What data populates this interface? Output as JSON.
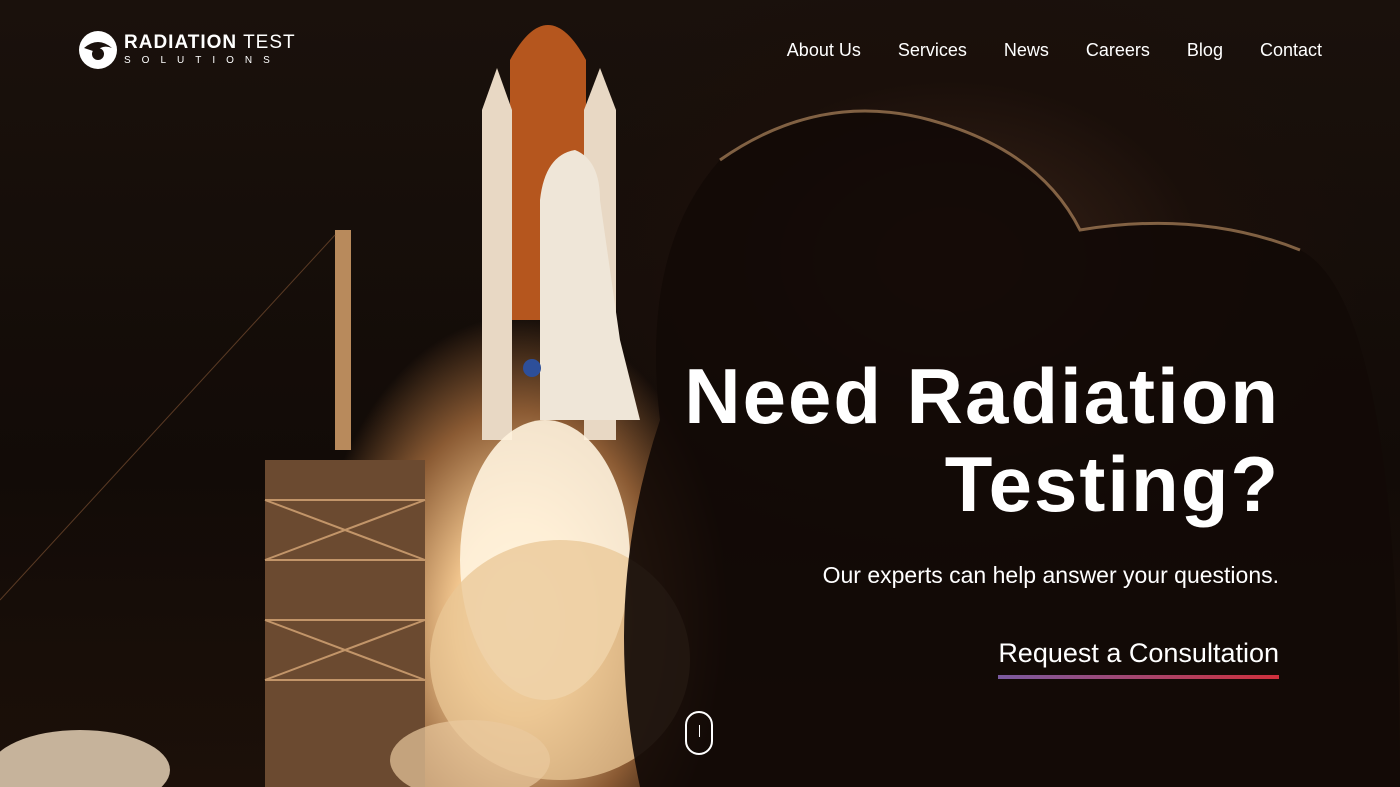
{
  "brand": {
    "line1_bold": "RADIATION",
    "line1_light": " TEST",
    "line2": "SOLUTIONS",
    "logo_icon": "eye-globe-icon"
  },
  "nav": {
    "items": [
      "About Us",
      "Services",
      "News",
      "Careers",
      "Blog",
      "Contact"
    ]
  },
  "hero": {
    "headline_line1": "Need Radiation",
    "headline_line2": "Testing?",
    "subtitle": "Our experts can help answer your questions.",
    "cta_label": "Request a Consultation",
    "background": "space-shuttle-launch-photo",
    "scroll_icon": "mouse-scroll-icon"
  },
  "colors": {
    "cta_gradient_start": "#7a5aa0",
    "cta_gradient_end": "#d0303c",
    "text": "#ffffff"
  }
}
